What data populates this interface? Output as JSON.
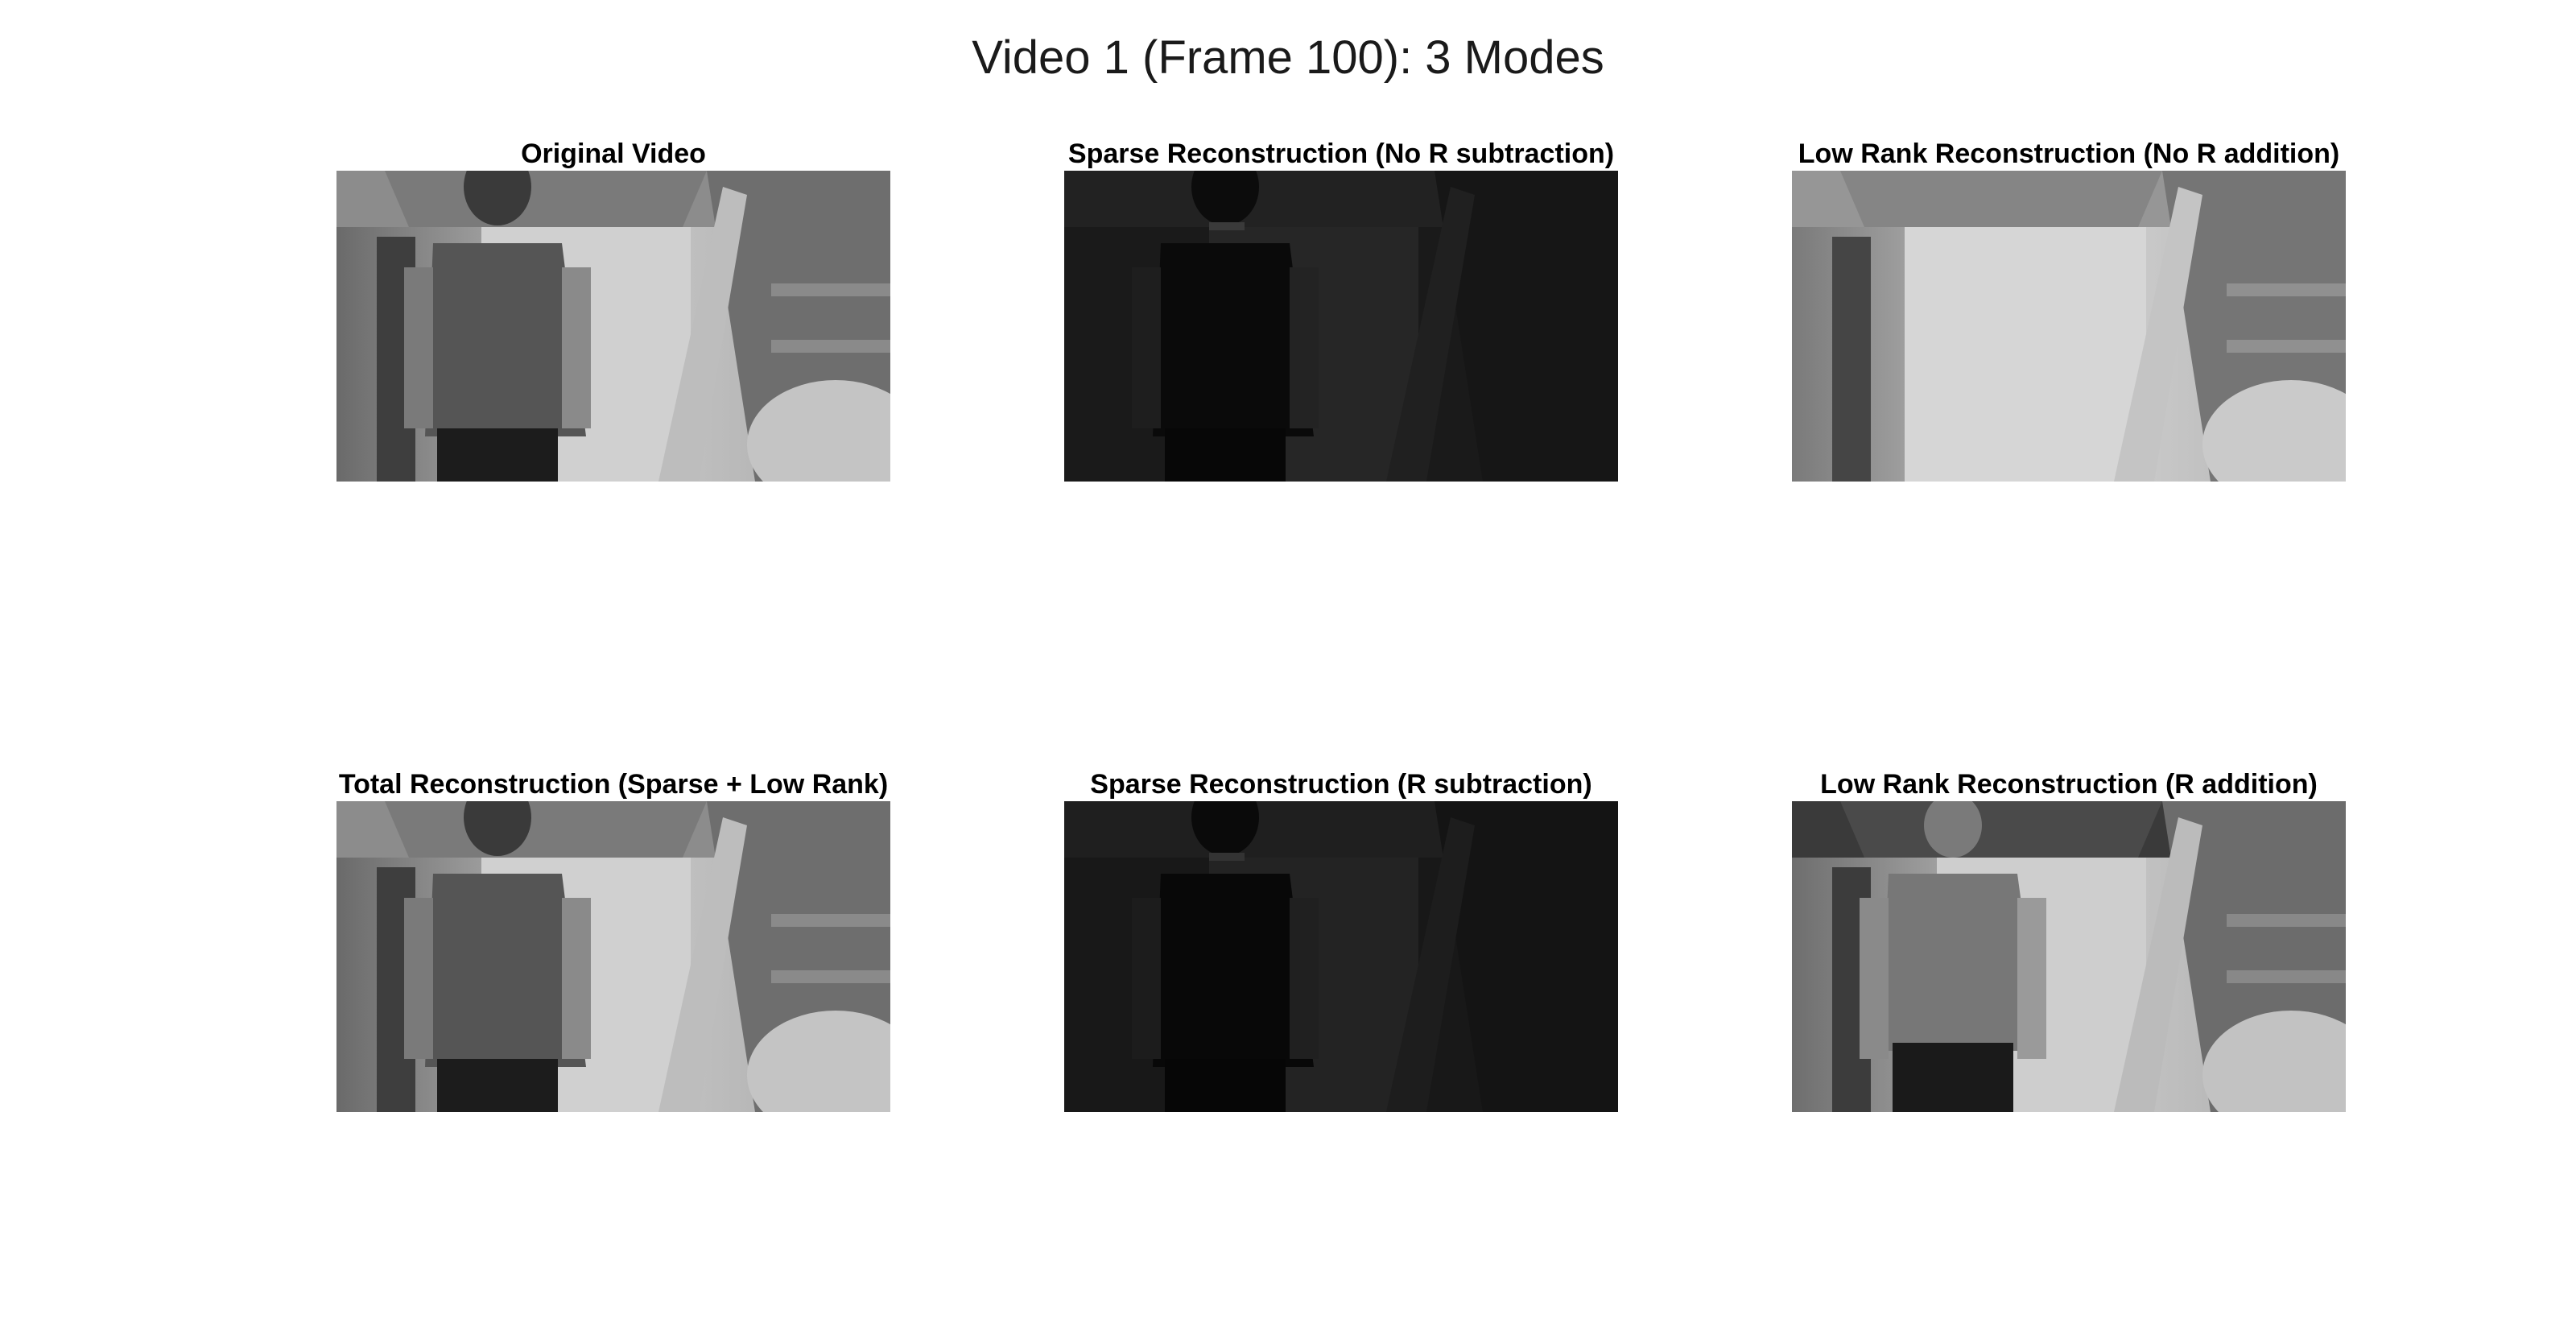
{
  "figure": {
    "title": "Video 1 (Frame 100): 3 Modes",
    "panels": [
      {
        "title": "Original Video",
        "mode": "original"
      },
      {
        "title": "Sparse Reconstruction (No R subtraction)",
        "mode": "sparse-dark"
      },
      {
        "title": "Low Rank Reconstruction (No R addition)",
        "mode": "background"
      },
      {
        "title": "Total Reconstruction (Sparse + Low Rank)",
        "mode": "original"
      },
      {
        "title": "Sparse Reconstruction (R subtraction)",
        "mode": "sparse-dark"
      },
      {
        "title": "Low Rank Reconstruction (R addition)",
        "mode": "background-ghost"
      }
    ]
  }
}
